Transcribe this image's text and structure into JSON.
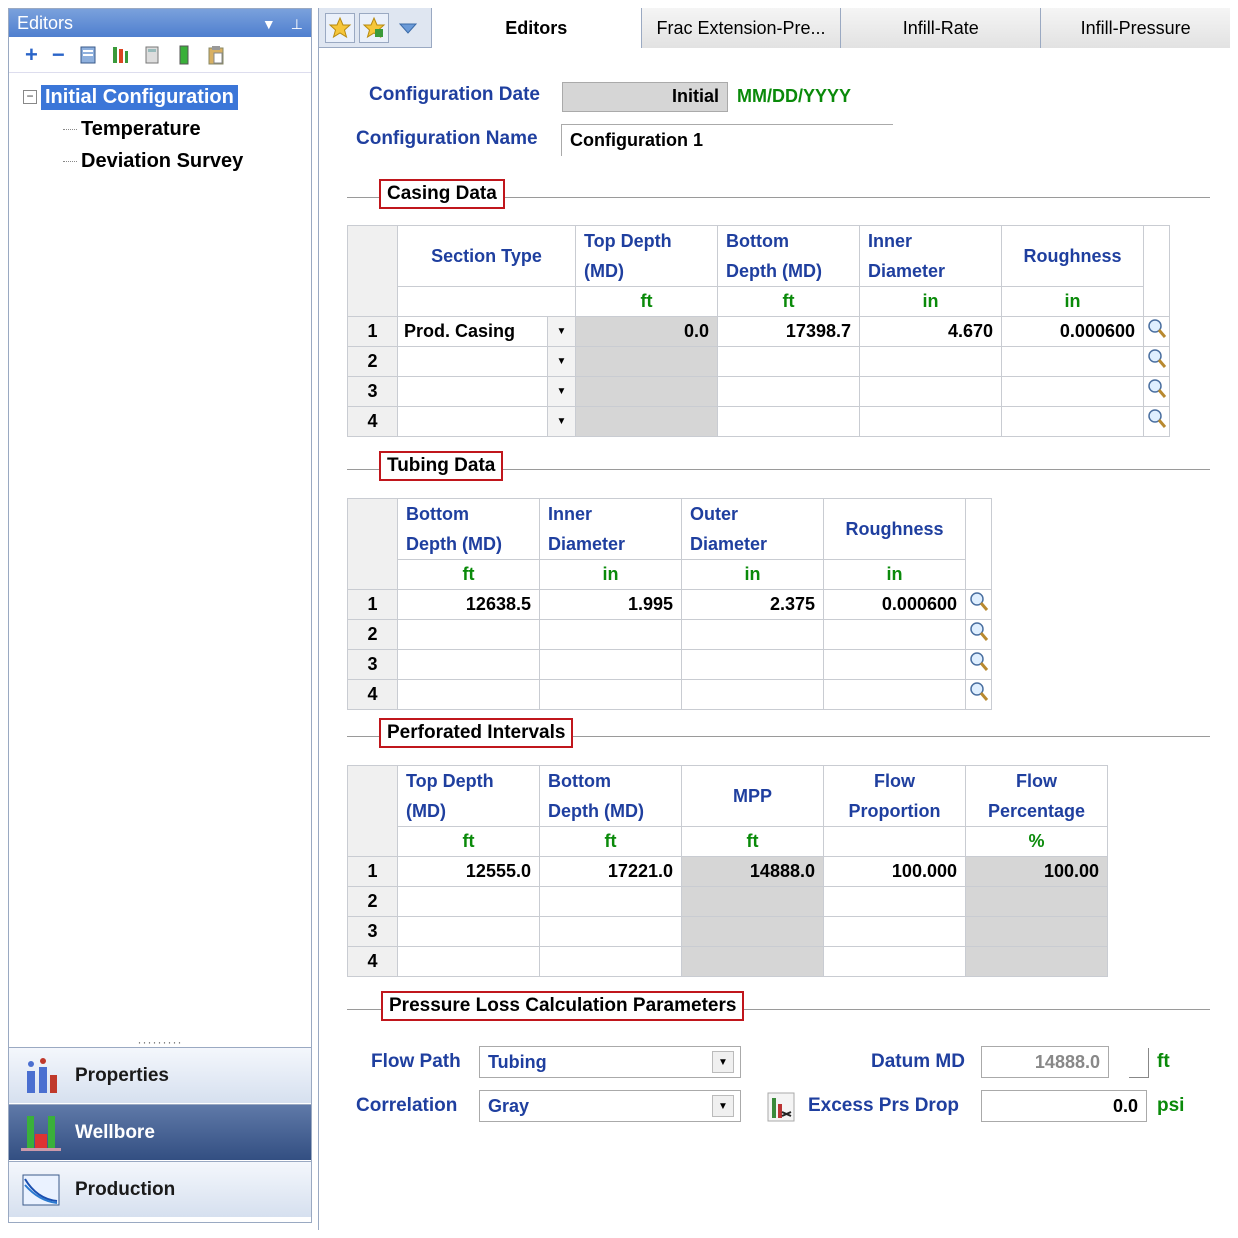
{
  "left_panel": {
    "title": "Editors",
    "tree": {
      "root": "Initial Configuration",
      "children": [
        "Temperature",
        "Deviation Survey"
      ]
    },
    "grip": "·········",
    "nav": [
      {
        "label": "Properties",
        "icon": "properties-icon"
      },
      {
        "label": "Wellbore",
        "icon": "wellbore-icon",
        "active": true
      },
      {
        "label": "Production",
        "icon": "production-icon"
      }
    ]
  },
  "tabs": [
    {
      "label": "Editors",
      "active": true
    },
    {
      "label": "Frac Extension-Pre..."
    },
    {
      "label": "Infill-Rate"
    },
    {
      "label": "Infill-Pressure"
    }
  ],
  "config": {
    "date_label": "Configuration Date",
    "date_value": "Initial",
    "date_format": "MM/DD/YYYY",
    "name_label": "Configuration Name",
    "name_value": "Configuration 1"
  },
  "casing": {
    "title": "Casing Data",
    "headers": [
      "Section Type",
      "Top Depth (MD)",
      "Bottom Depth (MD)",
      "Inner Diameter",
      "Roughness"
    ],
    "header_lines": [
      [
        "Section Type"
      ],
      [
        "Top Depth",
        "(MD)"
      ],
      [
        "Bottom",
        "Depth (MD)"
      ],
      [
        "Inner",
        "Diameter"
      ],
      [
        "Roughness"
      ]
    ],
    "units": [
      "",
      "ft",
      "ft",
      "in",
      "in"
    ],
    "rows": [
      {
        "n": "1",
        "section": "Prod. Casing",
        "top": "0.0",
        "bottom": "17398.7",
        "id": "4.670",
        "rough": "0.000600"
      },
      {
        "n": "2",
        "section": "",
        "top": "",
        "bottom": "",
        "id": "",
        "rough": ""
      },
      {
        "n": "3",
        "section": "",
        "top": "",
        "bottom": "",
        "id": "",
        "rough": ""
      },
      {
        "n": "4",
        "section": "",
        "top": "",
        "bottom": "",
        "id": "",
        "rough": ""
      }
    ]
  },
  "tubing": {
    "title": "Tubing Data",
    "header_lines": [
      [
        "Bottom",
        "Depth (MD)"
      ],
      [
        "Inner",
        "Diameter"
      ],
      [
        "Outer",
        "Diameter"
      ],
      [
        "Roughness"
      ]
    ],
    "units": [
      "ft",
      "in",
      "in",
      "in"
    ],
    "rows": [
      {
        "n": "1",
        "bottom": "12638.5",
        "id": "1.995",
        "od": "2.375",
        "rough": "0.000600"
      },
      {
        "n": "2",
        "bottom": "",
        "id": "",
        "od": "",
        "rough": ""
      },
      {
        "n": "3",
        "bottom": "",
        "id": "",
        "od": "",
        "rough": ""
      },
      {
        "n": "4",
        "bottom": "",
        "id": "",
        "od": "",
        "rough": ""
      }
    ]
  },
  "perforations": {
    "title": "Perforated Intervals",
    "header_lines": [
      [
        "Top Depth",
        "(MD)"
      ],
      [
        "Bottom",
        "Depth (MD)"
      ],
      [
        "MPP"
      ],
      [
        "Flow",
        "Proportion"
      ],
      [
        "Flow",
        "Percentage"
      ]
    ],
    "units": [
      "ft",
      "ft",
      "ft",
      "",
      "%"
    ],
    "rows": [
      {
        "n": "1",
        "top": "12555.0",
        "bottom": "17221.0",
        "mpp": "14888.0",
        "prop": "100.000",
        "pct": "100.00"
      },
      {
        "n": "2",
        "top": "",
        "bottom": "",
        "mpp": "",
        "prop": "",
        "pct": ""
      },
      {
        "n": "3",
        "top": "",
        "bottom": "",
        "mpp": "",
        "prop": "",
        "pct": ""
      },
      {
        "n": "4",
        "top": "",
        "bottom": "",
        "mpp": "",
        "prop": "",
        "pct": ""
      }
    ]
  },
  "pressure": {
    "title": "Pressure Loss Calculation Parameters",
    "flow_path_label": "Flow Path",
    "flow_path_value": "Tubing",
    "correlation_label": "Correlation",
    "correlation_value": "Gray",
    "datum_label": "Datum MD",
    "datum_value": "14888.0",
    "datum_unit": "ft",
    "excess_label": "Excess Prs Drop",
    "excess_value": "0.0",
    "excess_unit": "psi"
  },
  "colors": {
    "accent_blue": "#1f3f9f",
    "unit_green": "#0a8a0a",
    "section_red": "#c0161c"
  }
}
